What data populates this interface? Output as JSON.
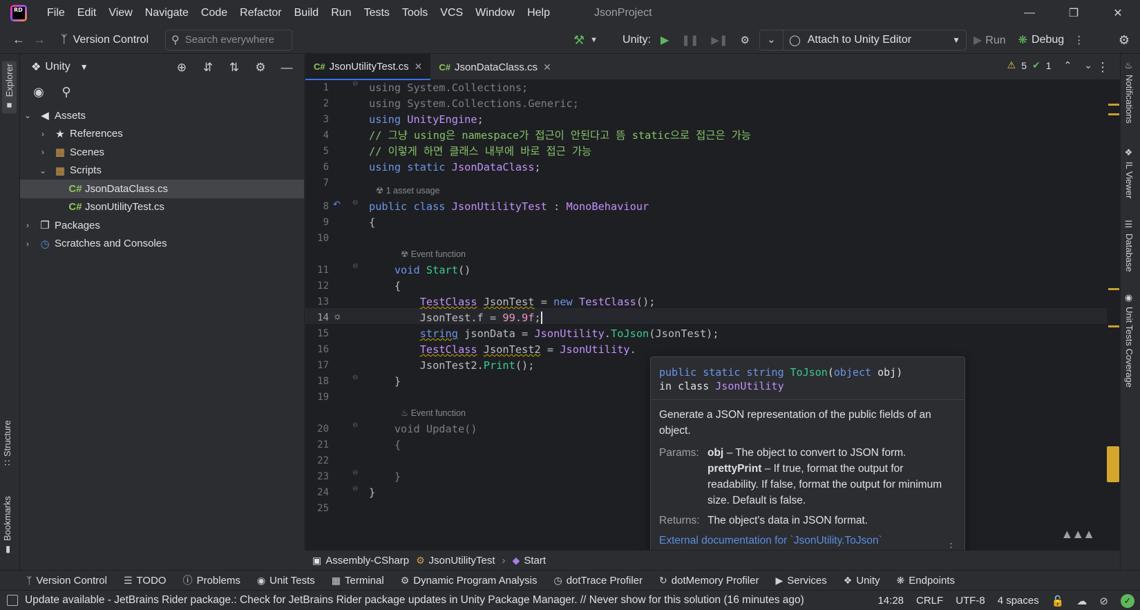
{
  "app": {
    "logo_text": "RD",
    "project_name": "JsonProject",
    "menu": [
      "File",
      "Edit",
      "View",
      "Navigate",
      "Code",
      "Refactor",
      "Build",
      "Run",
      "Tests",
      "Tools",
      "VCS",
      "Window",
      "Help"
    ]
  },
  "toolbar": {
    "vcs_label": "Version Control",
    "search_placeholder": "Search everywhere",
    "unity_label": "Unity:",
    "run_config": "Attach to Unity Editor",
    "run_label": "Run",
    "debug_label": "Debug"
  },
  "left_stripe": {
    "explorer": "Explorer",
    "structure": "Structure",
    "bookmarks": "Bookmarks"
  },
  "explorer": {
    "title": "Unity",
    "tree": [
      {
        "label": "Assets",
        "depth": 0,
        "expanded": true,
        "icon": "assets"
      },
      {
        "label": "References",
        "depth": 1,
        "expanded": false,
        "icon": "references"
      },
      {
        "label": "Scenes",
        "depth": 1,
        "expanded": false,
        "icon": "folder"
      },
      {
        "label": "Scripts",
        "depth": 1,
        "expanded": true,
        "icon": "folder"
      },
      {
        "label": "JsonDataClass.cs",
        "depth": 2,
        "icon": "cs",
        "selected": true
      },
      {
        "label": "JsonUtilityTest.cs",
        "depth": 2,
        "icon": "cs"
      },
      {
        "label": "Packages",
        "depth": 0,
        "expanded": false,
        "icon": "package"
      },
      {
        "label": "Scratches and Consoles",
        "depth": 0,
        "expanded": false,
        "icon": "scratch"
      }
    ]
  },
  "editor": {
    "tabs": [
      {
        "lang": "C#",
        "label": "JsonUtilityTest.cs",
        "active": true
      },
      {
        "lang": "C#",
        "label": "JsonDataClass.cs",
        "active": false
      }
    ],
    "inspection": {
      "warnings": "5",
      "ok": "1"
    },
    "hints": {
      "asset_usage": "1 asset usage",
      "event_function_start": "Event function",
      "event_function_update": "Event function"
    },
    "line_numbers": [
      "1",
      "2",
      "3",
      "4",
      "5",
      "6",
      "7",
      "8",
      "9",
      "10",
      "11",
      "12",
      "13",
      "14",
      "15",
      "16",
      "17",
      "18",
      "19",
      "20",
      "21",
      "22",
      "23",
      "24",
      "25"
    ],
    "current_line": 14
  },
  "doc_popup": {
    "signature_kw1": "public static string",
    "signature_fn": "ToJson",
    "signature_param_type": "object",
    "signature_param": "obj",
    "signature_in": "in class",
    "signature_class": "JsonUtility",
    "description": "Generate a JSON representation of the public fields of an object.",
    "params_label": "Params:",
    "param1_name": "obj",
    "param1_desc": "– The object to convert to JSON form.",
    "param2_name": "prettyPrint",
    "param2_desc": "– If true, format the output for readability. If false, format the output for minimum size. Default is false.",
    "returns_label": "Returns:",
    "returns_desc": "The object's data in JSON format.",
    "link": "External documentation for `JsonUtility.ToJson`"
  },
  "breadcrumb": [
    "Assembly-CSharp",
    "JsonUtilityTest",
    "Start"
  ],
  "right_stripe": [
    "Notifications",
    "IL Viewer",
    "Database",
    "Unit Tests Coverage"
  ],
  "tool_windows": [
    "Version Control",
    "TODO",
    "Problems",
    "Unit Tests",
    "Terminal",
    "Dynamic Program Analysis",
    "dotTrace Profiler",
    "dotMemory Profiler",
    "Services",
    "Unity",
    "Endpoints"
  ],
  "status": {
    "message": "Update available - JetBrains Rider package.: Check for JetBrains Rider package updates in Unity Package Manager. // Never show for this solution (16 minutes ago)",
    "position": "14:28",
    "line_sep": "CRLF",
    "encoding": "UTF-8",
    "indent": "4 spaces"
  }
}
